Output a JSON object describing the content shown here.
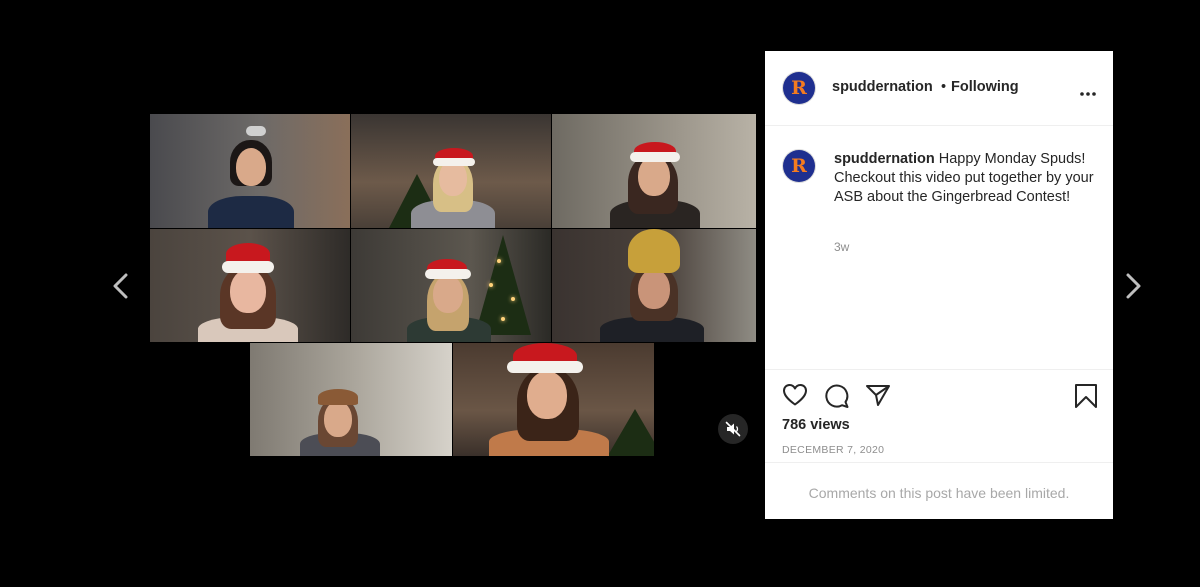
{
  "post": {
    "username": "spuddernation",
    "separator": "•",
    "follow_status": "Following",
    "avatar_letter": "R",
    "caption_text": "Happy Monday Spuds! Checkout this video put together by your ASB about the Gingerbread Contest!",
    "time_ago": "3w",
    "views": "786 views",
    "date": "DECEMBER 7, 2020",
    "comments_notice": "Comments on this post have been limited."
  },
  "icons": {
    "prev": "chevron-left-icon",
    "next": "chevron-right-icon",
    "mute": "speaker-muted-icon",
    "more": "more-horizontal-icon",
    "like": "heart-icon",
    "comment": "comment-icon",
    "share": "paper-plane-icon",
    "save": "bookmark-icon"
  },
  "colors": {
    "background": "#000000",
    "panel": "#ffffff",
    "text": "#262626",
    "muted_text": "#8e8e8e",
    "avatar_bg": "#1f2f8f",
    "avatar_letter": "#f47b20"
  }
}
